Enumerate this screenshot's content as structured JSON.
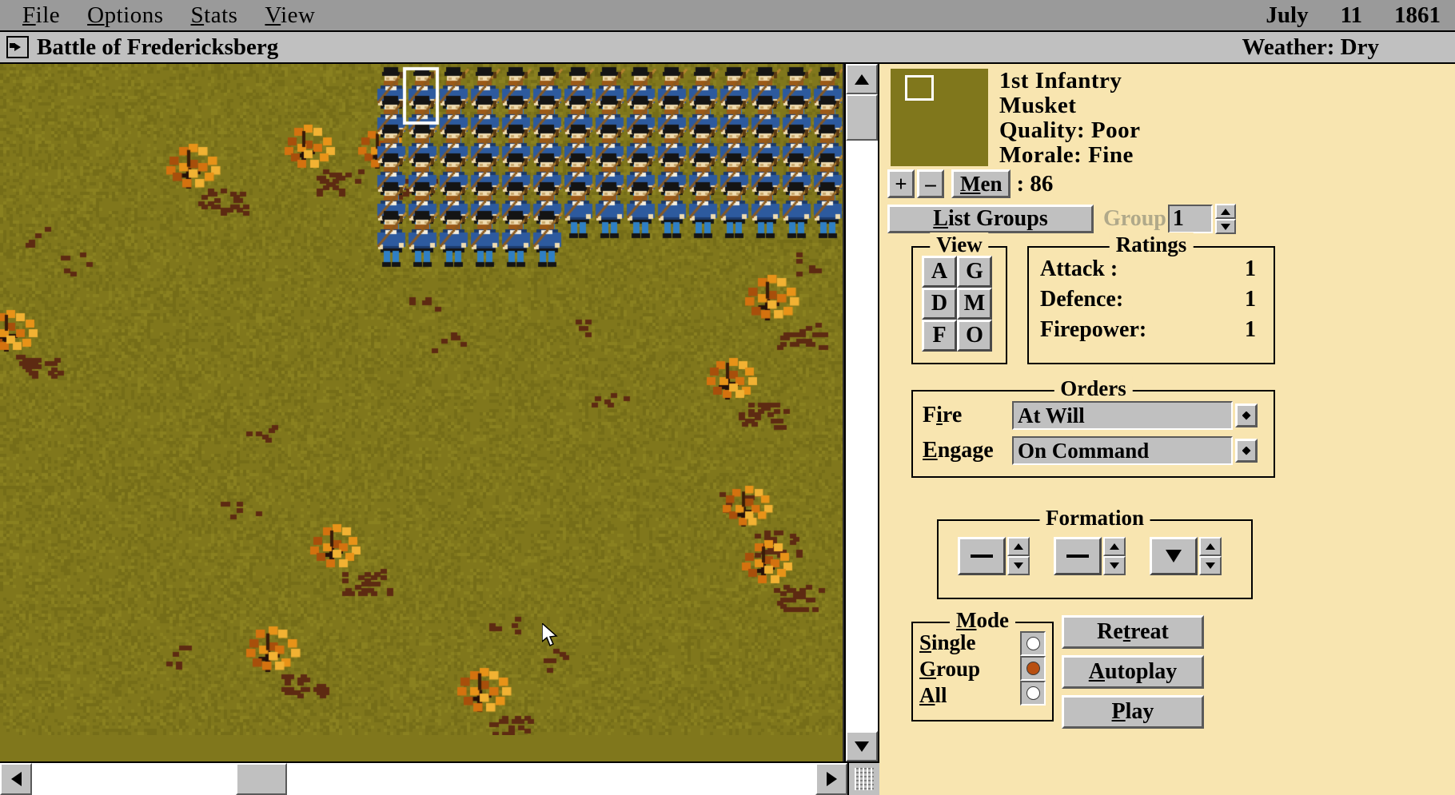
{
  "menu": {
    "items": [
      {
        "pre": "",
        "key": "F",
        "post": "ile",
        "name": "menu-file"
      },
      {
        "pre": "",
        "key": "O",
        "post": "ptions",
        "name": "menu-options"
      },
      {
        "pre": "",
        "key": "S",
        "post": "tats",
        "name": "menu-stats"
      },
      {
        "pre": "",
        "key": "V",
        "post": "iew",
        "name": "menu-view"
      }
    ],
    "labels": {
      "file": "File",
      "options": "Options",
      "stats": "Stats",
      "view": "View"
    }
  },
  "date": {
    "month": "July",
    "day": "11",
    "year": "1861"
  },
  "titlebar": {
    "battle": "Battle of Fredericksberg",
    "weather": "Weather: Dry"
  },
  "unit": {
    "name": "1st  Infantry",
    "weapon": "Musket",
    "quality": "Quality: Poor",
    "morale": "Morale: Fine",
    "men_label": "Men",
    "men_prefix": ": ",
    "men_value": "86",
    "plus": "+",
    "minus": "–"
  },
  "groups": {
    "list_button": "List Groups",
    "list_button_key": "L",
    "list_button_rest": "ist Groups",
    "group_label": "Group",
    "group_value": "1"
  },
  "view": {
    "legend": "View",
    "buttons": [
      "A",
      "G",
      "D",
      "M",
      "F",
      "O"
    ]
  },
  "ratings": {
    "legend": "Ratings",
    "rows": [
      {
        "label": "Attack :",
        "value": "1"
      },
      {
        "label": "Defence:",
        "value": "1"
      },
      {
        "label": "Firepower:",
        "value": "1"
      }
    ]
  },
  "orders": {
    "legend": "Orders",
    "fire": {
      "label_pre": "F",
      "label_key": "i",
      "label_post": "re",
      "value": "At Will"
    },
    "engage": {
      "label_key": "E",
      "label_post": "ngage",
      "value": "On Command"
    }
  },
  "formation": {
    "legend": "Formation",
    "controls": [
      {
        "glyph": "dash",
        "name": "formation-width-spinner"
      },
      {
        "glyph": "dash",
        "name": "formation-depth-spinner"
      },
      {
        "glyph": "down",
        "name": "formation-facing-spinner"
      }
    ]
  },
  "mode": {
    "legend": "Mode",
    "legend_key": "M",
    "legend_rest": "ode",
    "options": [
      {
        "label": "Single",
        "key": "S",
        "rest": "ingle",
        "selected": false
      },
      {
        "label": "Group",
        "key": "G",
        "rest": "roup",
        "selected": true
      },
      {
        "label": "All",
        "key": "A",
        "rest": "ll",
        "selected": false
      }
    ],
    "selected_color": "#b84f11"
  },
  "actions": [
    {
      "label": "Retreat",
      "pre": "Re",
      "key": "t",
      "post": "reat",
      "name": "retreat-button"
    },
    {
      "label": "Autoplay",
      "pre": "",
      "key": "A",
      "post": "utoplay",
      "name": "autoplay-button"
    },
    {
      "label": "Play",
      "pre": "",
      "key": "P",
      "post": "lay",
      "name": "play-button"
    }
  ],
  "map": {
    "terrain_color": "#80771c",
    "units_faction": "union-blue-infantry",
    "selection_marker": "white-rectangle",
    "rows": 6,
    "cols": 16
  },
  "colors": {
    "panel_bg": "#f8e5b0",
    "chrome": "#c0c0c0",
    "menubar": "#9a9a9a",
    "terrain": "#80771c",
    "uniform_blue": "#2d5a9e",
    "tree_orange": "#e08a18"
  }
}
